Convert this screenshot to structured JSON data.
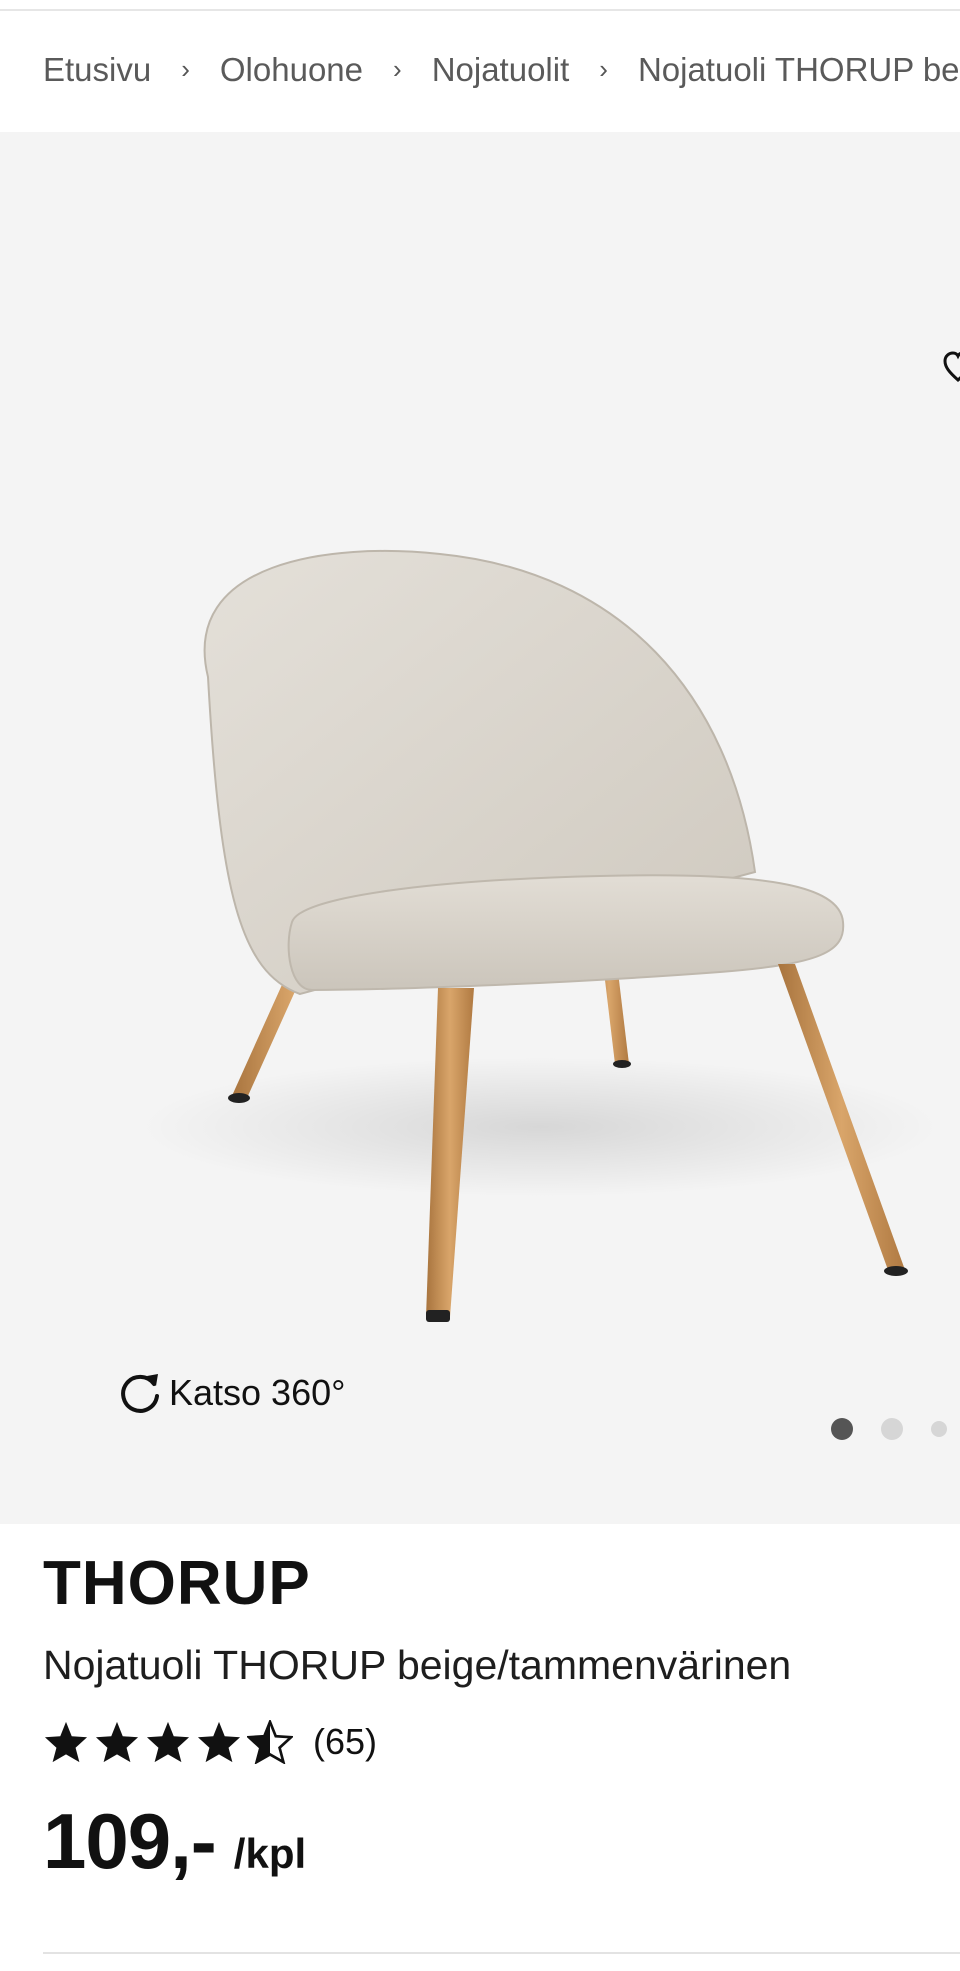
{
  "breadcrumb": [
    {
      "label": "Etusivu"
    },
    {
      "label": "Olohuone"
    },
    {
      "label": "Nojatuolit"
    },
    {
      "label": "Nojatuoli THORUP beige/tammenvärinen"
    }
  ],
  "breadcrumb_separator": "›",
  "gallery": {
    "view360_label": "Katso 360°",
    "active_index": 0,
    "image_count": 3
  },
  "product": {
    "brand": "THORUP",
    "description": "Nojatuoli THORUP beige/tammenvärinen",
    "rating": 4.5,
    "rating_max": 5,
    "review_count": "(65)",
    "price": "109,-",
    "price_unit": "/kpl"
  },
  "colors": {
    "gallery_bg": "#f4f4f4",
    "text": "#111111",
    "fabric": "#d9d4cc",
    "wood": "#c38c50"
  }
}
